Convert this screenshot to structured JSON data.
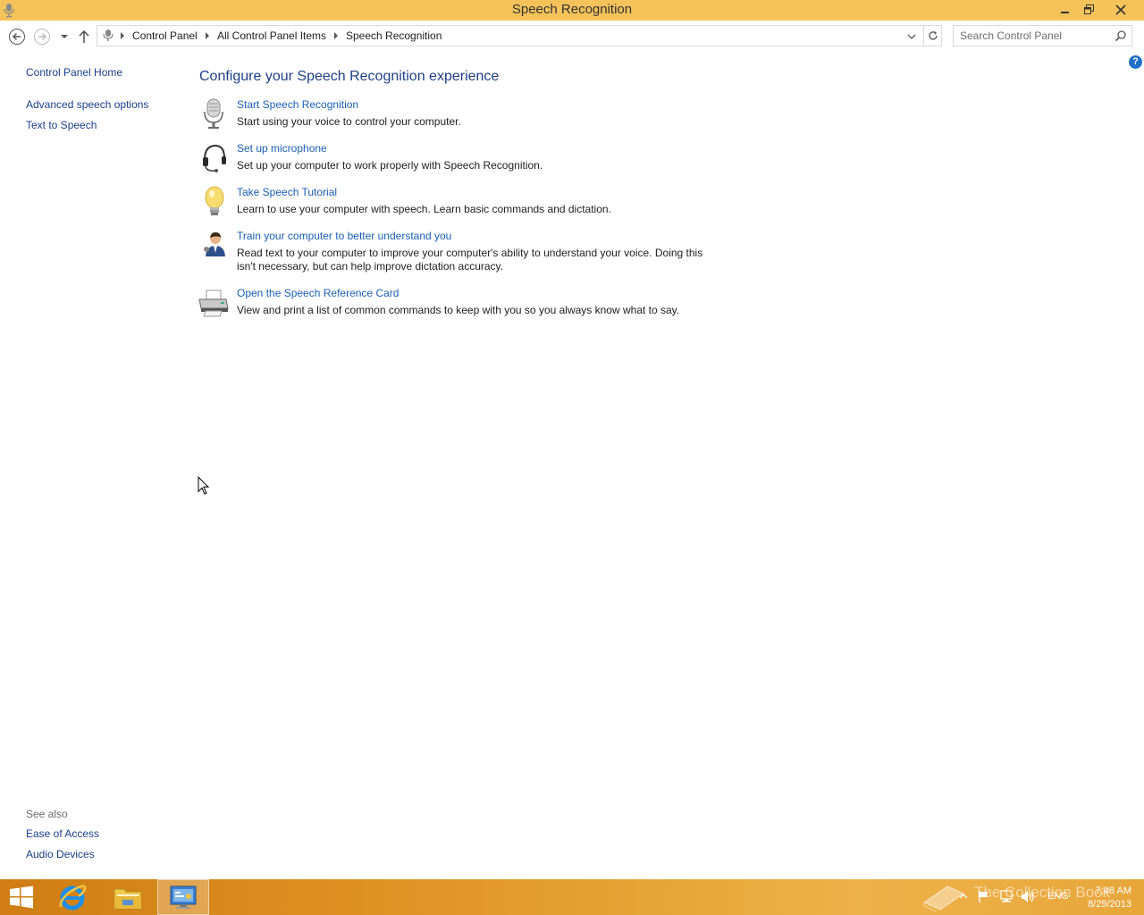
{
  "window": {
    "title": "Speech Recognition",
    "titlebar_color": "#f5c35a"
  },
  "nav": {
    "breadcrumbs": [
      "Control Panel",
      "All Control Panel Items",
      "Speech Recognition"
    ],
    "search_placeholder": "Search Control Panel"
  },
  "sidebar": {
    "home": "Control Panel Home",
    "links": [
      "Advanced speech options",
      "Text to Speech"
    ],
    "see_also_title": "See also",
    "see_also": [
      "Ease of Access",
      "Audio Devices"
    ]
  },
  "main": {
    "heading": "Configure your Speech Recognition experience",
    "tasks": [
      {
        "label": "Start Speech Recognition",
        "desc": "Start using your voice to control your computer.",
        "icon": "microphone-icon"
      },
      {
        "label": "Set up microphone",
        "desc": "Set up your computer to work properly with Speech Recognition.",
        "icon": "headset-icon"
      },
      {
        "label": "Take Speech Tutorial",
        "desc": "Learn to use your computer with speech.  Learn basic commands and dictation.",
        "icon": "lightbulb-icon"
      },
      {
        "label": "Train your computer to better understand you",
        "desc": "Read text to your computer to improve your computer's ability to understand your voice.  Doing this isn't necessary, but can help improve dictation accuracy.",
        "icon": "user-training-icon"
      },
      {
        "label": "Open the Speech Reference Card",
        "desc": "View and print a list of common commands to keep with you so you always know what to say.",
        "icon": "printer-icon"
      }
    ]
  },
  "taskbar": {
    "language": "ENG",
    "time": "7:48 AM",
    "date": "8/29/2013",
    "watermark": "The Collection Book"
  },
  "colors": {
    "link": "#1a5fb4",
    "heading": "#1e3f88",
    "accent": "#1f6fc7"
  }
}
